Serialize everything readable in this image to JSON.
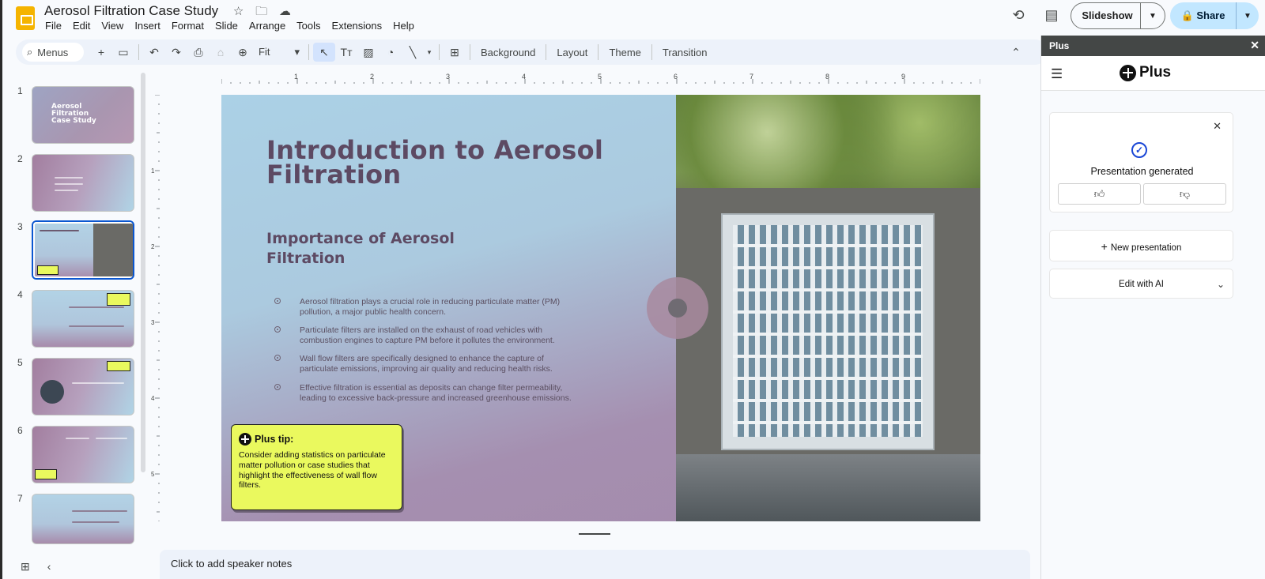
{
  "app": {
    "title": "Aerosol Filtration Case Study",
    "menu": [
      "File",
      "Edit",
      "View",
      "Insert",
      "Format",
      "Slide",
      "Arrange",
      "Tools",
      "Extensions",
      "Help"
    ],
    "slideshow_label": "Slideshow",
    "share_label": "Share"
  },
  "toolbar": {
    "search_label": "Menus",
    "zoom_value": "Fit",
    "background_label": "Background",
    "layout_label": "Layout",
    "theme_label": "Theme",
    "transition_label": "Transition"
  },
  "filmstrip": {
    "numbers": [
      "1",
      "2",
      "3",
      "4",
      "5",
      "6",
      "7"
    ],
    "slide1_title": "Aerosol Filtration Case Study",
    "selected": "3"
  },
  "ruler": {
    "top_marks": [
      "1",
      "2",
      "3",
      "4",
      "5",
      "6",
      "7",
      "8",
      "9"
    ],
    "left_marks": [
      "1",
      "2",
      "3",
      "4",
      "5"
    ]
  },
  "slide": {
    "title": "Introduction to Aerosol Filtration",
    "subtitle": "Importance of Aerosol Filtration",
    "bullets": [
      "Aerosol filtration plays a crucial role in reducing particulate matter (PM) pollution, a major public health concern.",
      "Particulate filters are installed on the exhaust of road vehicles with combustion engines to capture PM before it pollutes the environment.",
      "Wall flow filters are specifically designed to enhance the capture of particulate emissions, improving air quality and reducing health risks.",
      "Effective filtration is essential as deposits can change filter permeability, leading to excessive back-pressure and increased greenhouse emissions."
    ],
    "tip_heading": "Plus tip:",
    "tip_body": "Consider adding statistics on particulate matter pollution or case studies that highlight the effectiveness of wall flow filters."
  },
  "notes": {
    "placeholder": "Click to add speaker notes"
  },
  "panel": {
    "bar_title": "Plus",
    "brand": "Plus",
    "generated_text": "Presentation generated",
    "new_presentation": "New presentation",
    "edit_with_ai": "Edit with AI"
  },
  "colors": {
    "accent": "#0b57d0",
    "tip_bg": "#eaf95e",
    "title_color": "#5d4a63"
  }
}
